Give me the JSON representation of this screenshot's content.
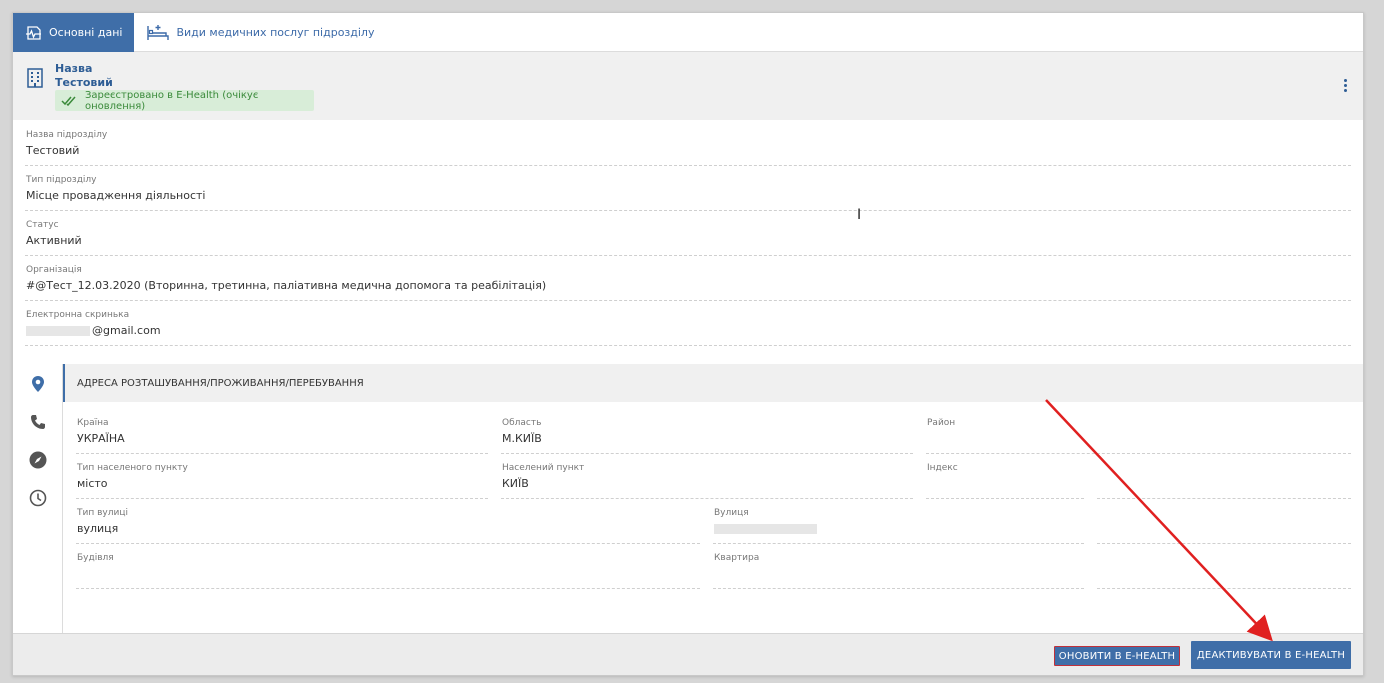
{
  "tabs": [
    {
      "label": "Основні дані",
      "active": true,
      "icon": "heart-pulse-icon"
    },
    {
      "label": "Види медичних послуг підрозділу",
      "active": false,
      "icon": "hospital-bed-icon"
    }
  ],
  "header": {
    "label": "Назва",
    "value": "Тестовий",
    "badge": "Зареєстровано в E-Health (очікує оновлення)",
    "badge_icon": "double-check-icon"
  },
  "fields": [
    {
      "label": "Назва підрозділу",
      "value": "Тестовий"
    },
    {
      "label": "Тип підрозділу",
      "value": "Місце провадження діяльності"
    },
    {
      "label": "Статус",
      "value": "Активний"
    },
    {
      "label": "Організація",
      "value": "#@Тест_12.03.2020 (Вторинна, третинна, паліативна медична допомога та реабілітація)"
    },
    {
      "label": "Електронна скринька",
      "value": "@gmail.com"
    }
  ],
  "address": {
    "title": "АДРЕСА РОЗТАШУВАННЯ/ПРОЖИВАННЯ/ПЕРЕБУВАННЯ",
    "country": {
      "label": "Країна",
      "value": "УКРАЇНА"
    },
    "region": {
      "label": "Область",
      "value": "М.КИЇВ"
    },
    "district": {
      "label": "Район",
      "value": ""
    },
    "settlement_type": {
      "label": "Тип населеного пункту",
      "value": "місто"
    },
    "settlement": {
      "label": "Населений пункт",
      "value": "КИЇВ"
    },
    "index": {
      "label": "Індекс",
      "value": ""
    },
    "street_type": {
      "label": "Тип вулиці",
      "value": "вулиця"
    },
    "street": {
      "label": "Вулиця",
      "value": ""
    },
    "building": {
      "label": "Будівля",
      "value": ""
    },
    "apartment": {
      "label": "Квартира",
      "value": ""
    }
  },
  "side_icons": [
    "location-pin-icon",
    "phone-icon",
    "compass-icon",
    "clock-icon"
  ],
  "buttons": {
    "update": "ОНОВИТИ В E-HEALTH",
    "deactivate": "ДЕАКТИВУВАТИ В E-HEALTH"
  },
  "colors": {
    "accent": "#3f6ea8",
    "badge_bg": "#d8edd8",
    "badge_text": "#3a8a3a",
    "annotation_arrow": "#e02020"
  }
}
